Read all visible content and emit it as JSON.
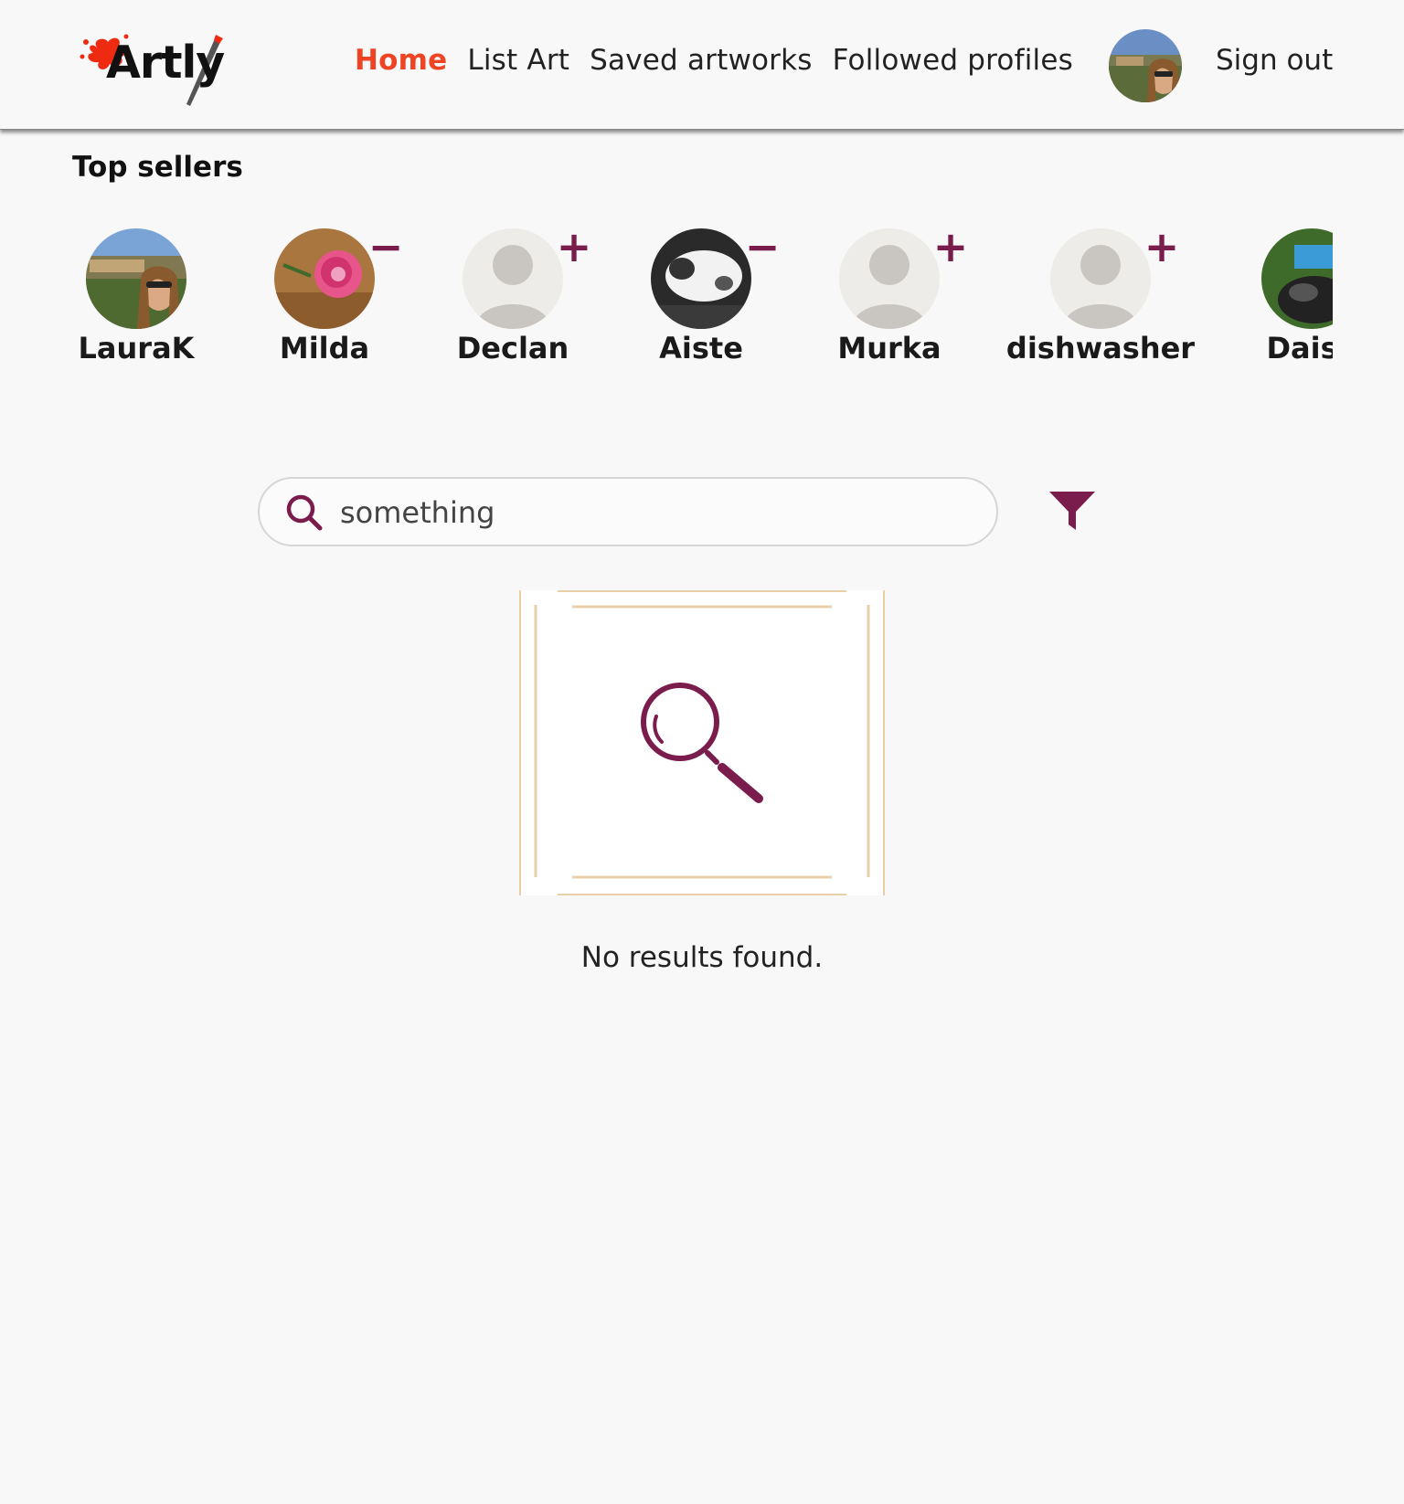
{
  "header": {
    "logo_text": "Artly",
    "nav": [
      {
        "label": "Home",
        "active": true
      },
      {
        "label": "List Art",
        "active": false
      },
      {
        "label": "Saved artworks",
        "active": false
      },
      {
        "label": "Followed profiles",
        "active": false
      }
    ],
    "sign_out_label": "Sign out"
  },
  "top_sellers": {
    "title": "Top sellers",
    "items": [
      {
        "name": "LauraK",
        "avatar": "landscape-photo",
        "follow_state": "self"
      },
      {
        "name": "Milda",
        "avatar": "flower-photo",
        "follow_state": "following",
        "action_symbol": "−"
      },
      {
        "name": "Declan",
        "avatar": "default-avatar",
        "follow_state": "not-following",
        "action_symbol": "+"
      },
      {
        "name": "Aiste",
        "avatar": "cat-photo",
        "follow_state": "following",
        "action_symbol": "−"
      },
      {
        "name": "Murka",
        "avatar": "default-avatar",
        "follow_state": "not-following",
        "action_symbol": "+"
      },
      {
        "name": "dishwasher",
        "avatar": "default-avatar",
        "follow_state": "not-following",
        "action_symbol": "+"
      },
      {
        "name": "Daisy",
        "avatar": "motorbike-photo",
        "follow_state": "unknown"
      }
    ]
  },
  "search": {
    "value": "something",
    "placeholder": "Search"
  },
  "results": {
    "empty_message": "No results found."
  },
  "colors": {
    "accent": "#ee4423",
    "brand_dark": "#7a1c4c",
    "frame": "#e8cfa8"
  }
}
